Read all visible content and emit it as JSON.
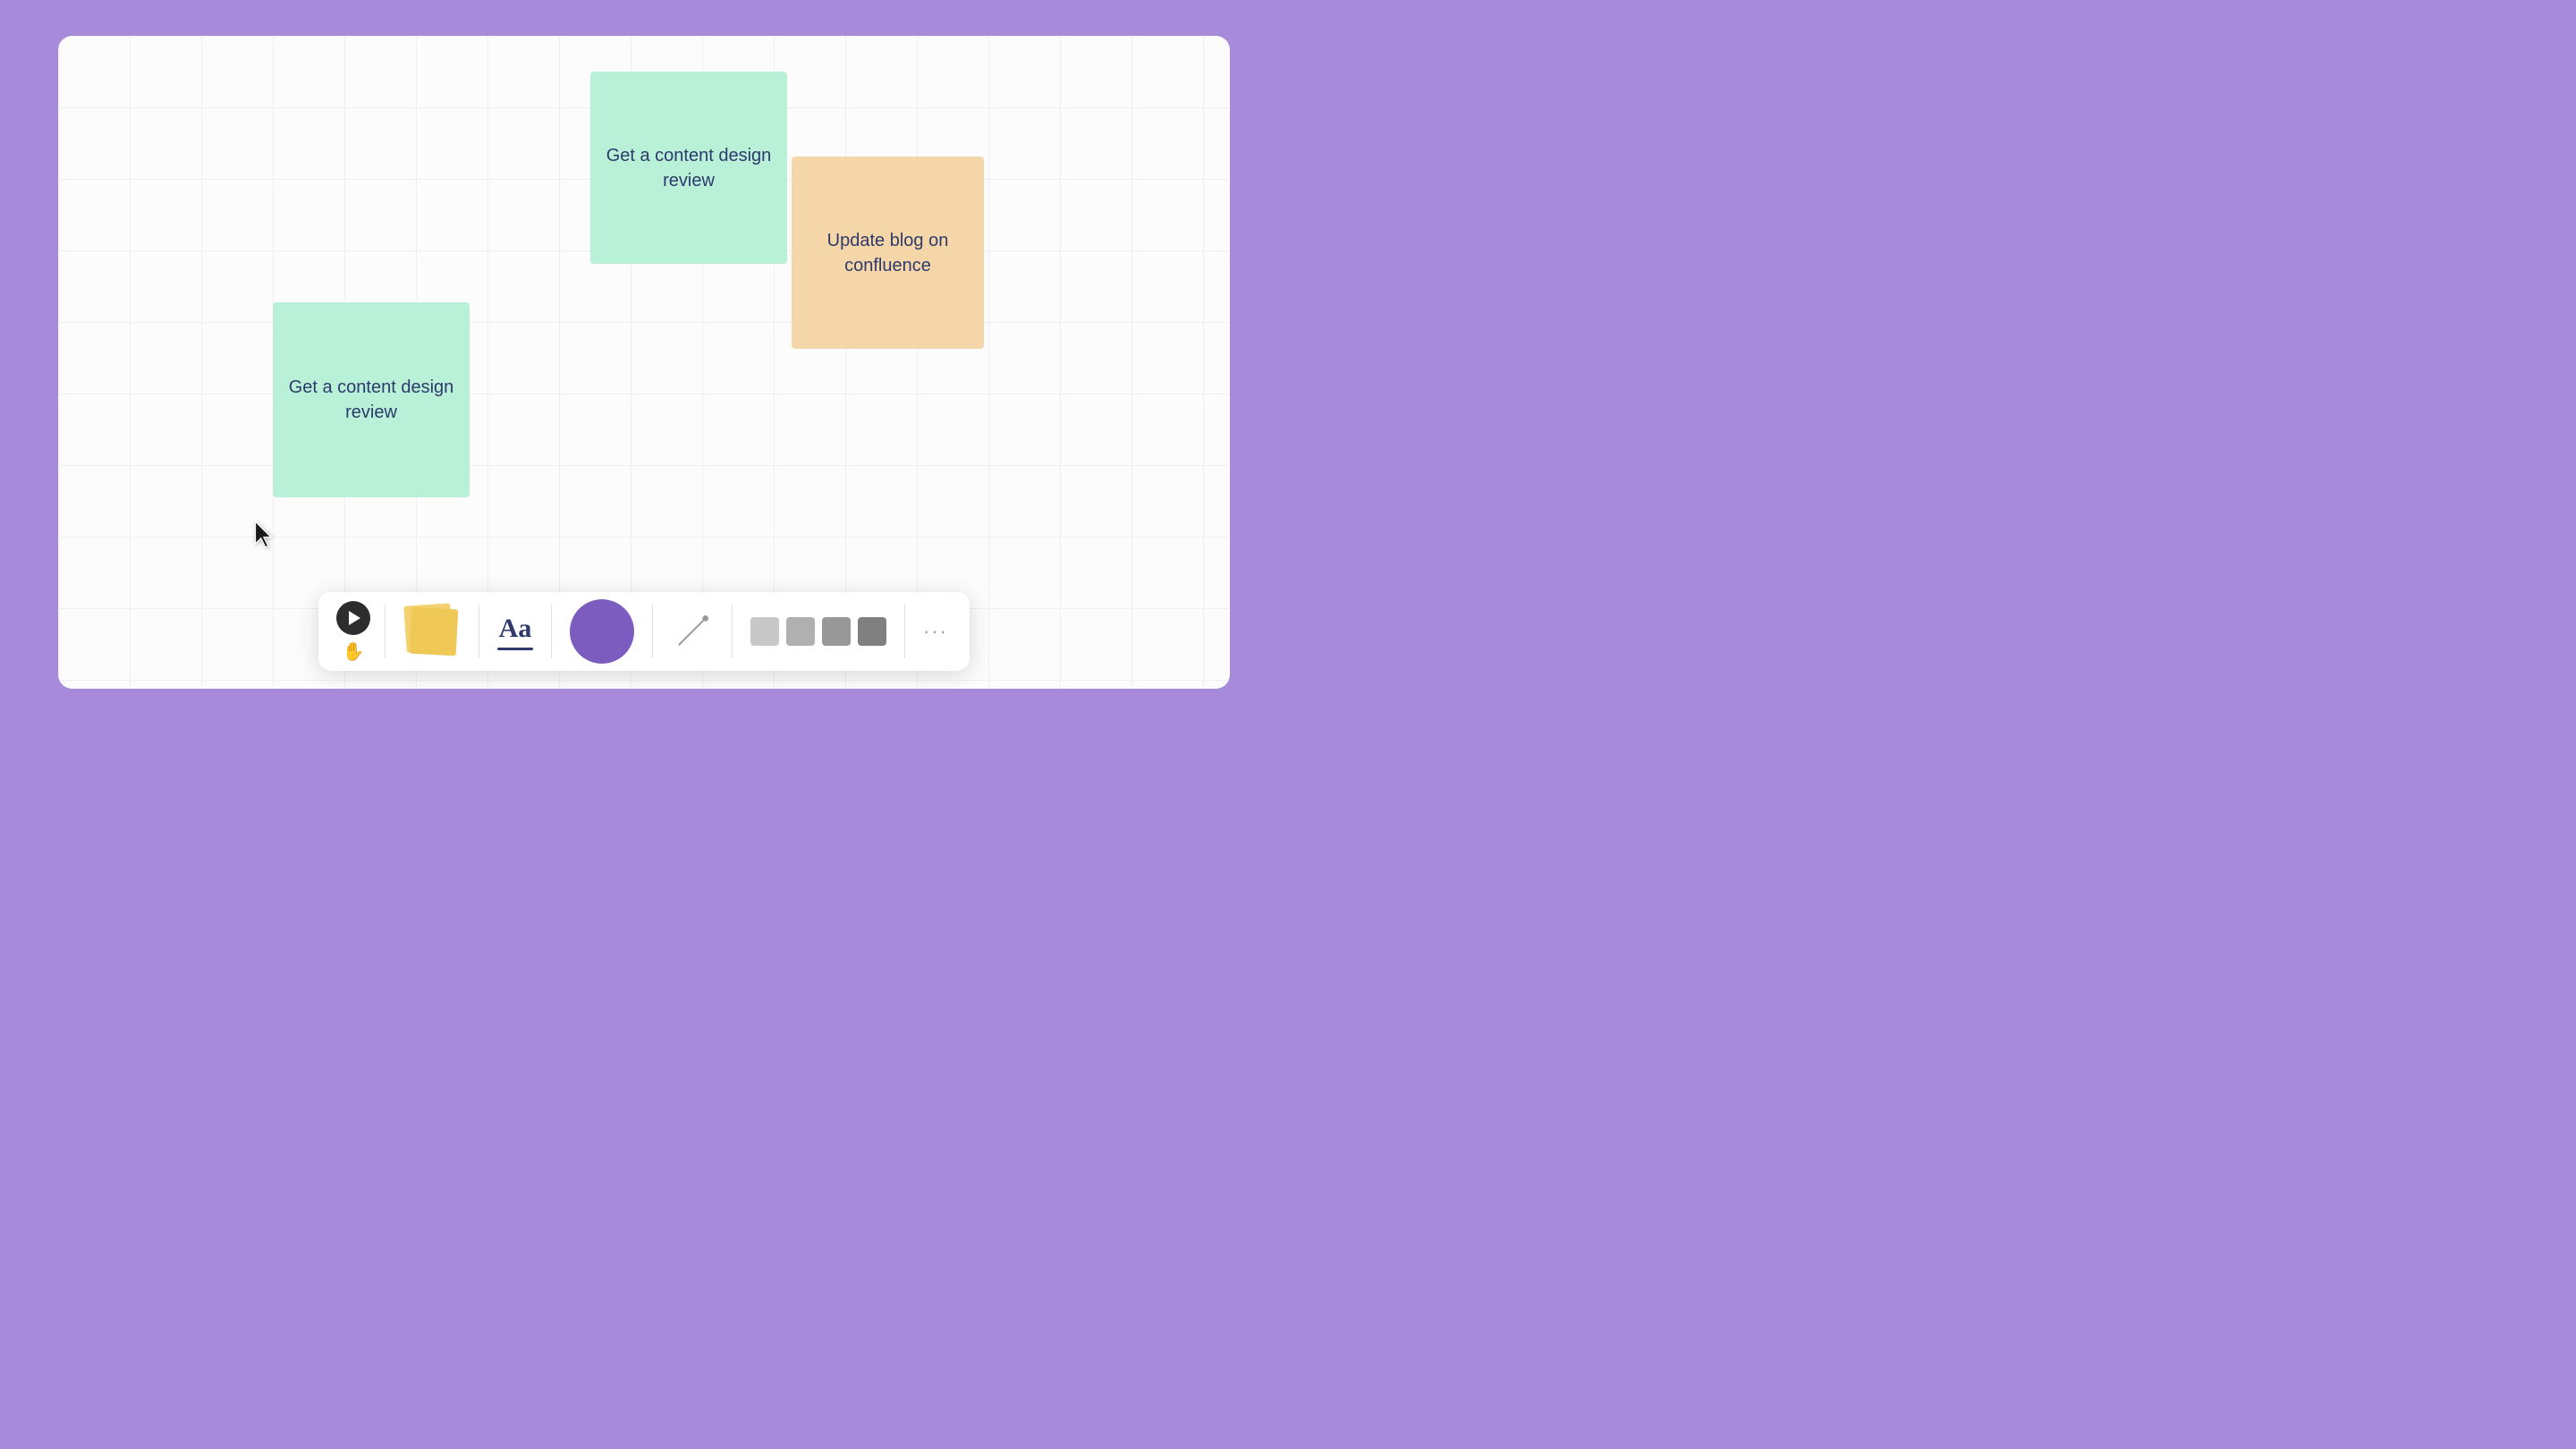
{
  "canvas": {
    "background_color": "#fafafa",
    "grid_color": "#e0e0e0"
  },
  "sticky_notes": [
    {
      "id": "note-green-top",
      "text": "Get a content design review",
      "color": "#b8f0d8",
      "text_color": "#2d3a6b"
    },
    {
      "id": "note-green-bottom",
      "text": "Get a content design review",
      "color": "#b8f0d8",
      "text_color": "#2d3a6b"
    },
    {
      "id": "note-orange",
      "text": "Update blog on confluence",
      "color": "#f5d6a8",
      "text_color": "#2d3a6b"
    }
  ],
  "toolbar": {
    "play_label": "▶",
    "hand_label": "✋",
    "text_tool_label": "Aa",
    "more_label": "···",
    "swatches": [
      {
        "color": "#c8c8c8",
        "label": "gray-light"
      },
      {
        "color": "#b0b0b0",
        "label": "gray-medium"
      },
      {
        "color": "#989898",
        "label": "gray-dark"
      },
      {
        "color": "#808080",
        "label": "gray-darker"
      }
    ]
  },
  "accent_color": "#a78bda"
}
